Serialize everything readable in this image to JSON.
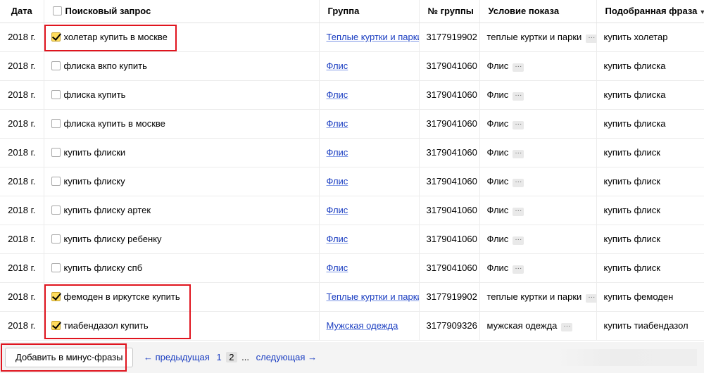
{
  "columns": {
    "date": "Дата",
    "query": "Поисковый запрос",
    "group": "Группа",
    "group_no": "№ группы",
    "condition": "Условие показа",
    "phrase": "Подобранная фраза",
    "sort_icon": "triangle-down-icon"
  },
  "rows": [
    {
      "date": "2018 г.",
      "checked": true,
      "query": "холетар купить в москве",
      "group": "Теплые куртки и парки",
      "group_no": "3177919902",
      "condition": "теплые куртки и парки",
      "more": "···",
      "phrase": "купить холетар"
    },
    {
      "date": "2018 г.",
      "checked": false,
      "query": "флиска вкпо купить",
      "group": "Флис",
      "group_no": "3179041060",
      "condition": "Флис",
      "more": "···",
      "phrase": "купить флиска"
    },
    {
      "date": "2018 г.",
      "checked": false,
      "query": "флиска купить",
      "group": "Флис",
      "group_no": "3179041060",
      "condition": "Флис",
      "more": "···",
      "phrase": "купить флиска"
    },
    {
      "date": "2018 г.",
      "checked": false,
      "query": "флиска купить в москве",
      "group": "Флис",
      "group_no": "3179041060",
      "condition": "Флис",
      "more": "···",
      "phrase": "купить флиска"
    },
    {
      "date": "2018 г.",
      "checked": false,
      "query": "купить флиски",
      "group": "Флис",
      "group_no": "3179041060",
      "condition": "Флис",
      "more": "···",
      "phrase": "купить флиск"
    },
    {
      "date": "2018 г.",
      "checked": false,
      "query": "купить флиску",
      "group": "Флис",
      "group_no": "3179041060",
      "condition": "Флис",
      "more": "···",
      "phrase": "купить флиск"
    },
    {
      "date": "2018 г.",
      "checked": false,
      "query": "купить флиску артек",
      "group": "Флис",
      "group_no": "3179041060",
      "condition": "Флис",
      "more": "···",
      "phrase": "купить флиск"
    },
    {
      "date": "2018 г.",
      "checked": false,
      "query": "купить флиску ребенку",
      "group": "Флис",
      "group_no": "3179041060",
      "condition": "Флис",
      "more": "···",
      "phrase": "купить флиск"
    },
    {
      "date": "2018 г.",
      "checked": false,
      "query": "купить флиску спб",
      "group": "Флис",
      "group_no": "3179041060",
      "condition": "Флис",
      "more": "···",
      "phrase": "купить флиск"
    },
    {
      "date": "2018 г.",
      "checked": true,
      "query": "фемоден в иркутске купить",
      "group": "Теплые куртки и парки",
      "group_no": "3177919902",
      "condition": "теплые куртки и парки",
      "more": "···",
      "phrase": "купить фемоден"
    },
    {
      "date": "2018 г.",
      "checked": true,
      "query": "тиабендазол купить",
      "group": "Мужская одежда",
      "group_no": "3177909326",
      "condition": "мужская одежда",
      "more": "···",
      "phrase": "купить тиабендазол"
    }
  ],
  "footer": {
    "add_button": "Добавить в минус-фразы",
    "prev": "← предыдущая",
    "page_1": "1",
    "page_2": "2",
    "ellipsis": "...",
    "next": "следующая →"
  },
  "colors": {
    "link": "#1a3dc1",
    "checkbox_checked": "#ffdc5c",
    "highlight_box": "#e0141e"
  }
}
